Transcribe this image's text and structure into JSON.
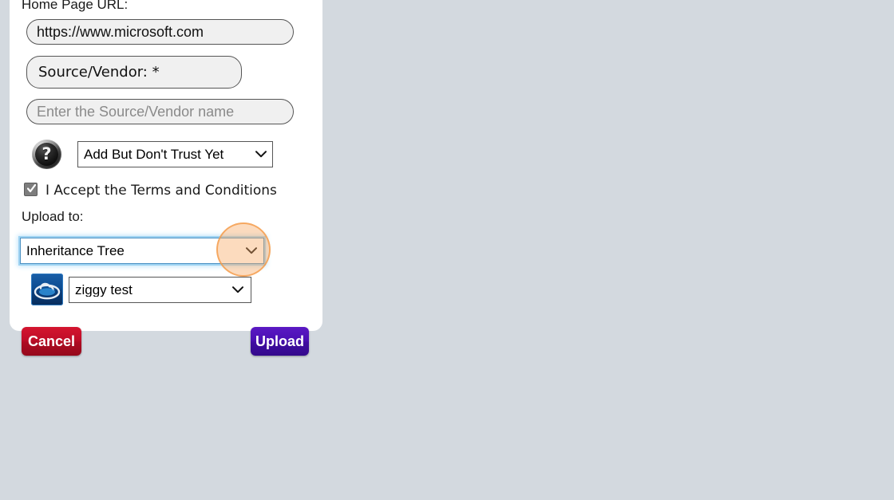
{
  "theme": {
    "page_background": "#d3d9df",
    "panel_background": "#ffffff",
    "focus_ring": "#9fd3f2",
    "highlight_circle": "#f49a46",
    "cancel_color": "#c00d28",
    "upload_color": "#4b10b4"
  },
  "form": {
    "home_page_url_label": "Home Page URL:",
    "home_page_url_value": "https://www.microsoft.com",
    "source_vendor_label": "Source/Vendor: *",
    "source_vendor_placeholder": "Enter the Source/Vendor name",
    "source_vendor_value": "",
    "trust_select_value": "Add But Don't Trust Yet",
    "trust_select_options": [
      "Add But Don't Trust Yet"
    ],
    "help_icon": "question-mark-icon",
    "terms_checkbox_checked": true,
    "terms_label": "I Accept the Terms and Conditions",
    "upload_to_label": "Upload to:",
    "upload_to_value": "Inheritance Tree",
    "upload_to_options": [
      "Inheritance Tree"
    ],
    "tree_icon": "cloud-tree-icon",
    "tree_select_value": "ziggy test",
    "tree_select_options": [
      "ziggy test"
    ]
  },
  "actions": {
    "cancel_label": "Cancel",
    "upload_label": "Upload"
  }
}
